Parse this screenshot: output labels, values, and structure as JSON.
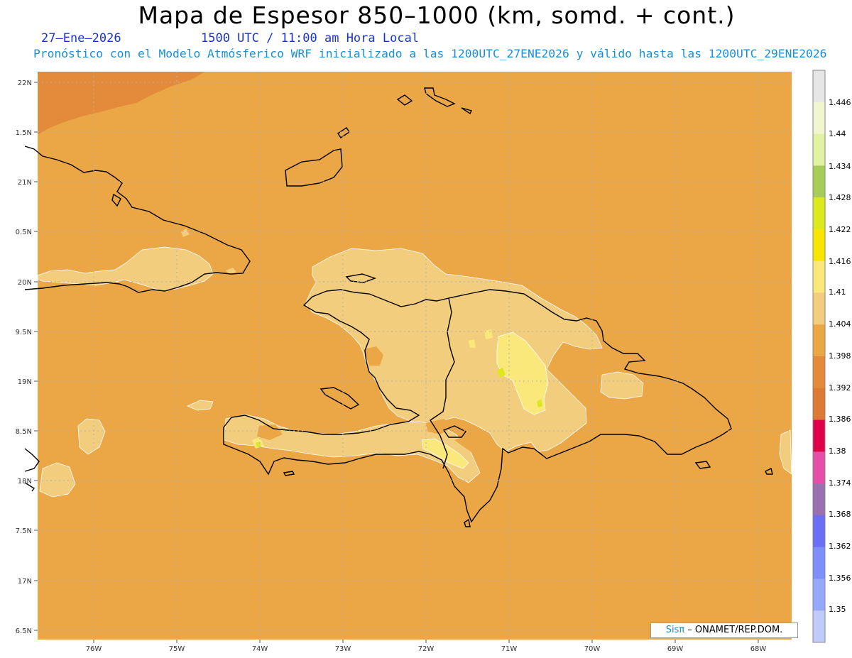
{
  "header": {
    "title": "Mapa de Espesor 850–1000 (km, somd. + cont.)",
    "date": "27–Ene–2026",
    "time": "1500 UTC / 11:00 am Hora Local",
    "forecast": "Pronóstico con el Modelo Atmósferico WRF inicializado a las 1200UTC_27ENE2026 y válido hasta las  1200UTC_29ENE2026"
  },
  "axes": {
    "lat_labels": [
      "22N",
      "1.5N",
      "21N",
      "0.5N",
      "20N",
      "9.5N",
      "19N",
      "8.5N",
      "18N",
      "7.5N",
      "17N",
      "6.5N"
    ],
    "lon_labels": [
      "76W",
      "75W",
      "74W",
      "73W",
      "72W",
      "71W",
      "70W",
      "69W",
      "68W"
    ]
  },
  "colorbar": {
    "labels": [
      "1.446",
      "1.44",
      "1.434",
      "1.428",
      "1.422",
      "1.416",
      "1.41",
      "1.404",
      "1.398",
      "1.392",
      "1.386",
      "1.38",
      "1.374",
      "1.368",
      "1.362",
      "1.356",
      "1.35"
    ],
    "colors": [
      "#e6e6e6",
      "#f1f5d0",
      "#e1f3a0",
      "#a6cc5a",
      "#dde91c",
      "#f9e600",
      "#fbe87a",
      "#f1cd7d",
      "#eba645",
      "#e38a3b",
      "#dd7a33",
      "#e0004a",
      "#e54fa8",
      "#9c6fb0",
      "#6b6ff3",
      "#7e8ffc",
      "#95a8fb",
      "#bfcbfa"
    ]
  },
  "map_colors": {
    "ocean": "#eba645",
    "low": "#e38a3b",
    "mid": "#f1cd7d",
    "high": "#fbe87a",
    "peak": "#dde91c",
    "coast": "#000000"
  },
  "credit": {
    "sis": "Sisπ",
    "rest": " – ONAMET/REP.DOM."
  }
}
